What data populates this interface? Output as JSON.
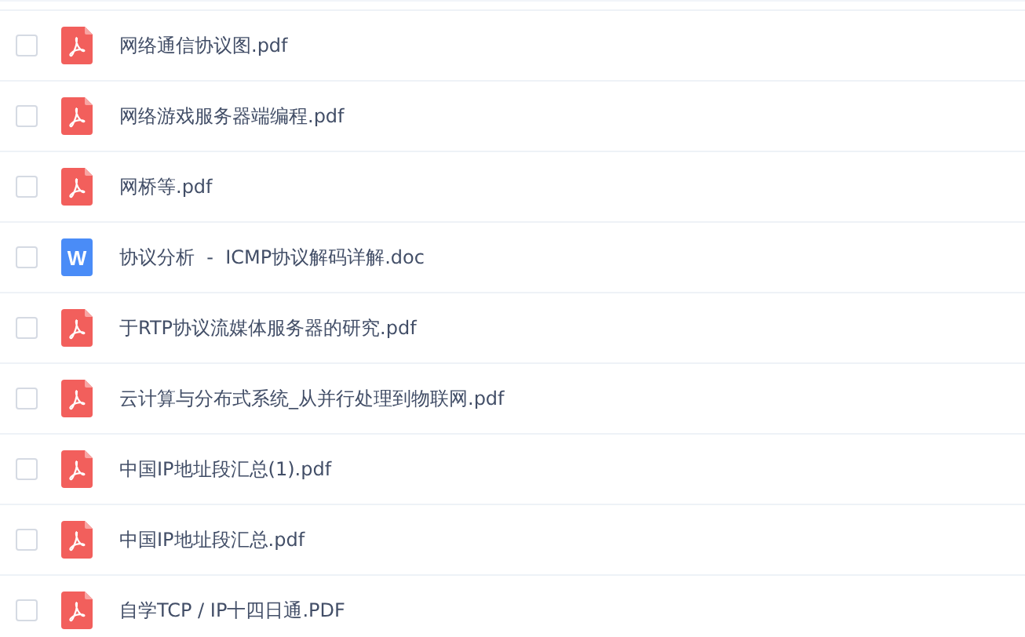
{
  "files": [
    {
      "name": "网络通信协议图.pdf",
      "kind": "pdf",
      "checked": false
    },
    {
      "name": "网络游戏服务器端编程.pdf",
      "kind": "pdf",
      "checked": false
    },
    {
      "name": "网桥等.pdf",
      "kind": "pdf",
      "checked": false
    },
    {
      "name": "协议分析  -  ICMP协议解码详解.doc",
      "kind": "word",
      "icon_text": "W",
      "checked": false
    },
    {
      "name": "于RTP协议流媒体服务器的研究.pdf",
      "kind": "pdf",
      "checked": false
    },
    {
      "name": "云计算与分布式系统_从并行处理到物联网.pdf",
      "kind": "pdf",
      "checked": false
    },
    {
      "name": "中国IP地址段汇总(1).pdf",
      "kind": "pdf",
      "checked": false
    },
    {
      "name": "中国IP地址段汇总.pdf",
      "kind": "pdf",
      "checked": false
    },
    {
      "name": "自学TCP / IP十四日通.PDF",
      "kind": "pdf",
      "checked": false
    }
  ]
}
